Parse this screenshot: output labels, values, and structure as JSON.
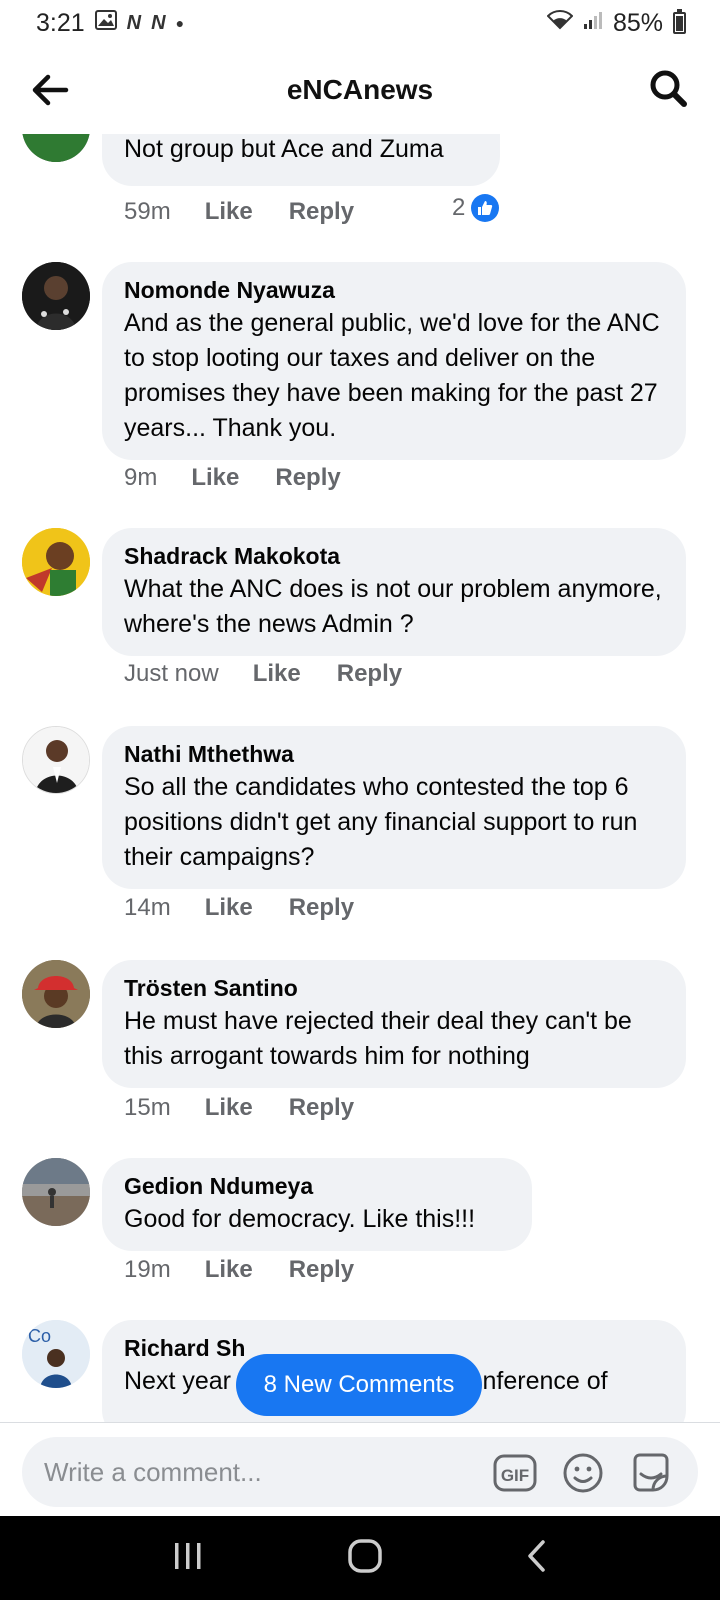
{
  "status_bar": {
    "time": "3:21",
    "battery": "85%",
    "battery_level": 0.85
  },
  "header": {
    "title": "eNCAnews"
  },
  "comments": [
    {
      "author": "",
      "text": "Not group but Ace and Zuma",
      "time": "59m",
      "like_label": "Like",
      "reply_label": "Reply",
      "reactions": "2"
    },
    {
      "author": "Nomonde Nyawuza",
      "text": "And as the general public, we'd love for the ANC to stop looting our taxes and deliver on the promises they have been making for the past 27 years... Thank you.",
      "time": "9m",
      "like_label": "Like",
      "reply_label": "Reply"
    },
    {
      "author": "Shadrack Makokota",
      "text": "What the ANC does is not our problem anymore, where's the news Admin ?",
      "time": "Just now",
      "like_label": "Like",
      "reply_label": "Reply"
    },
    {
      "author": "Nathi Mthethwa",
      "text": "So all the candidates who contested the top 6 positions didn't get any financial support to run their campaigns?",
      "time": "14m",
      "like_label": "Like",
      "reply_label": "Reply"
    },
    {
      "author": "Trösten Santino",
      "text": "He must have rejected their deal they can't be this arrogant towards him for nothing",
      "time": "15m",
      "like_label": "Like",
      "reply_label": "Reply"
    },
    {
      "author": "Gedion Ndumeya",
      "text": "Good for democracy. Like this!!!",
      "time": "19m",
      "like_label": "Like",
      "reply_label": "Reply"
    },
    {
      "author": "Richard Sh",
      "text": "Next year its national elective conference of"
    }
  ],
  "new_comments_pill": "8 New Comments",
  "composer": {
    "placeholder": "Write a comment...",
    "gif_label": "GIF"
  },
  "colors": {
    "accent": "#1877f2",
    "bubble": "#f0f2f5",
    "meta": "#65676b"
  }
}
